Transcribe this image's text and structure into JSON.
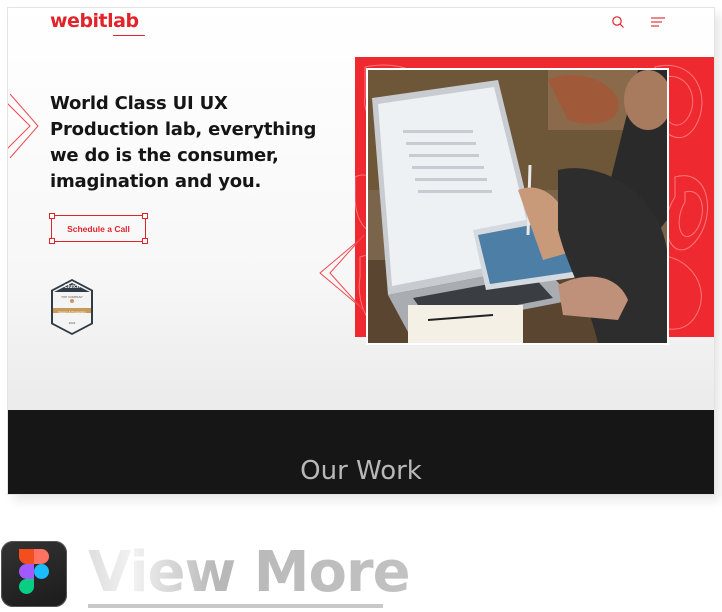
{
  "header": {
    "logo_text": "webitlab",
    "search_icon": "search-icon",
    "menu_icon": "menu-icon"
  },
  "hero": {
    "title": "World Class UI UX Production lab, everything we do is the consumer, imagination and you.",
    "cta_label": "Schedule a Call"
  },
  "badge": {
    "brand": "Clutch",
    "line1": "TOP COMPANY",
    "line2": "Design & Production",
    "year": "2023"
  },
  "work": {
    "heading": "Our Work"
  },
  "bottom": {
    "view_more": "View More",
    "app_icon": "figma-icon"
  },
  "colors": {
    "accent": "#e1242b",
    "dark_section": "#161616",
    "panel_red": "#ee2a30"
  }
}
